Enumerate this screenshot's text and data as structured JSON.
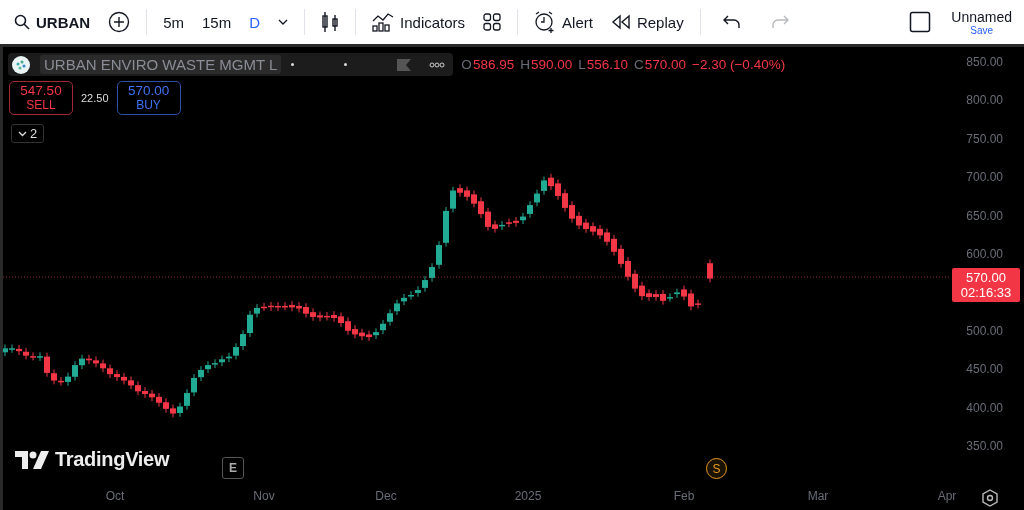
{
  "toolbar": {
    "symbol": "URBAN",
    "intervals": [
      {
        "label": "5m",
        "selected": false
      },
      {
        "label": "15m",
        "selected": false
      },
      {
        "label": "D",
        "selected": true
      }
    ],
    "indicators": "Indicators",
    "alert": "Alert",
    "replay": "Replay",
    "history": [
      {
        "kind": "undo",
        "disabled": false
      },
      {
        "kind": "redo",
        "disabled": true
      }
    ],
    "layout_name": "Unnamed",
    "save": "Save"
  },
  "legend": {
    "title": "URBAN ENVIRO WASTE MGMT L",
    "ohlc": [
      {
        "label": "O",
        "value": "586.95"
      },
      {
        "label": "H",
        "value": "590.00"
      },
      {
        "label": "L",
        "value": "556.10"
      },
      {
        "label": "C",
        "value": "570.00"
      }
    ],
    "change": "−2.30 (−0.40%)"
  },
  "trade": {
    "sell_price": "547.50",
    "sell_label": "SELL",
    "spread": "22.50",
    "buy_price": "570.00",
    "buy_label": "BUY"
  },
  "indicators_toggle": "2",
  "price_tag": {
    "price": "570.00",
    "countdown": "02:16:33"
  },
  "y_axis": [
    "850.00",
    "800.00",
    "750.00",
    "700.00",
    "650.00",
    "600.00",
    "500.00",
    "450.00",
    "400.00",
    "350.00"
  ],
  "x_axis": [
    "Oct",
    "Nov",
    "Dec",
    "2025",
    "Feb",
    "Mar",
    "Apr"
  ],
  "logo": "TradingView",
  "markers": [
    {
      "kind": "earnings",
      "label": "E"
    },
    {
      "kind": "split",
      "label": "S"
    }
  ]
}
